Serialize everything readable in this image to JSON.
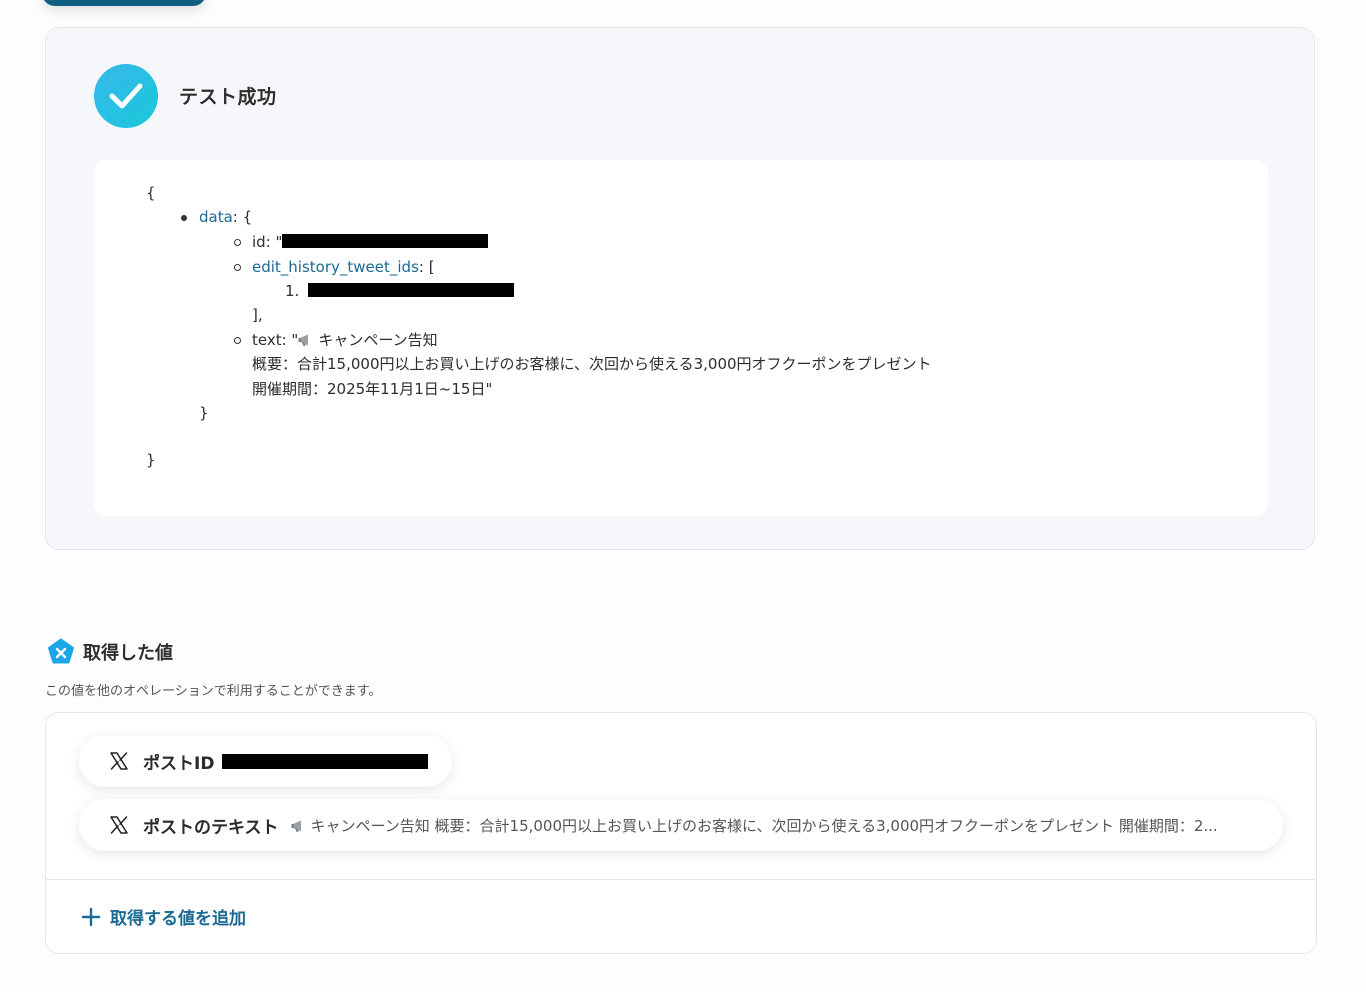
{
  "test_result": {
    "status_title": "テスト成功",
    "icon": "check-icon"
  },
  "json_output": {
    "open_brace": "{",
    "data_key": "data",
    "data_open": ": {",
    "id_key": "id",
    "id_prefix": ": \"",
    "edit_history_key": "edit_history_tweet_ids",
    "edit_history_open": ": [",
    "list_index": "1.",
    "array_close": "],",
    "text_key": "text",
    "text_prefix": ": \"",
    "text_line1": "キャンペーン告知",
    "text_line2": "概要：合計15,000円以上お買い上げのお客様に、次回から使える3,000円オフクーポンをプレゼント",
    "text_line3": "開催期間：2025年11月1日~15日\"",
    "data_close": "}",
    "close_brace": "}"
  },
  "retrieved": {
    "title": "取得した値",
    "description": "この値を他のオペレーションで利用することができます。",
    "items": [
      {
        "icon": "x-logo-icon",
        "label": "ポストID",
        "value": ""
      },
      {
        "icon": "x-logo-icon",
        "label": "ポストのテキスト",
        "value": "キャンペーン告知 概要：合計15,000円以上お買い上げのお客様に、次回から使える3,000円オフクーポンをプレゼント 開催期間：2..."
      }
    ],
    "add_label": "取得する値を追加"
  },
  "colors": {
    "accent": "#1a6a94",
    "success_gradient_start": "#37b7ec",
    "success_gradient_end": "#19c9d9",
    "panel_bg": "#f5f7fa"
  }
}
